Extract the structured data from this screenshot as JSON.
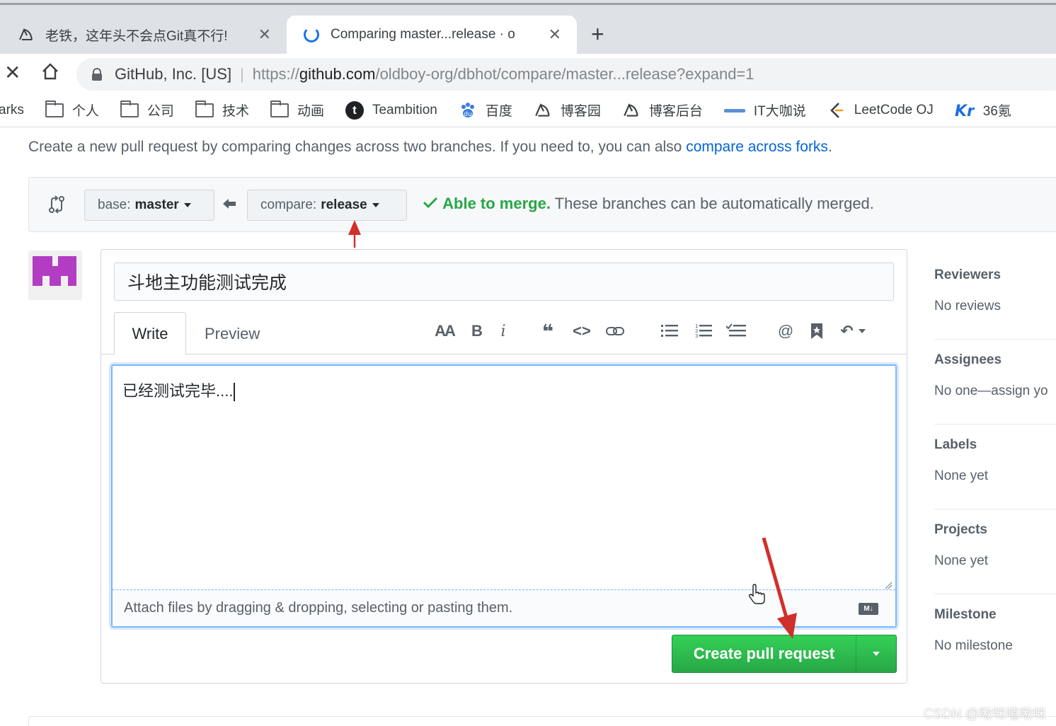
{
  "browser": {
    "tabs": [
      {
        "title": "老铁，这年头不会点Git真不行!",
        "active": false,
        "favicon": "cnblogs-icon"
      },
      {
        "title": "Comparing master...release · o",
        "active": true,
        "favicon": "loading-spinner-icon"
      }
    ],
    "new_tab_label": "+",
    "close_glyph": "✕",
    "stop_glyph": "✕",
    "home_glyph": "⌂",
    "address": {
      "org": "GitHub, Inc. [US]",
      "separator": "|",
      "scheme": "https://",
      "host": "github.com",
      "path": "/oldboy-org/dbhot/compare/master...release?expand=1"
    },
    "bookmarks": [
      {
        "label": "arks",
        "icon": "none"
      },
      {
        "label": "个人",
        "icon": "folder-icon"
      },
      {
        "label": "公司",
        "icon": "folder-icon"
      },
      {
        "label": "技术",
        "icon": "folder-icon"
      },
      {
        "label": "动画",
        "icon": "folder-icon"
      },
      {
        "label": "Teambition",
        "icon": "teambition-icon"
      },
      {
        "label": "百度",
        "icon": "baidu-paw-icon"
      },
      {
        "label": "博客园",
        "icon": "cnblogs-icon"
      },
      {
        "label": "博客后台",
        "icon": "cnblogs-icon"
      },
      {
        "label": "IT大咖说",
        "icon": "itdks-icon"
      },
      {
        "label": "LeetCode OJ",
        "icon": "leetcode-icon"
      },
      {
        "label": "36氪",
        "icon": "kr36-icon"
      }
    ]
  },
  "page": {
    "intro_text": "Create a new pull request by comparing changes across two branches. If you need to, you can also ",
    "intro_link": "compare across forks",
    "intro_end": ".",
    "base_prefix": "base:",
    "base_branch": "master",
    "compare_prefix": "compare:",
    "compare_branch": "release",
    "merge_ok": "Able to merge.",
    "merge_text": " These branches can be automatically merged.",
    "pr_title": "斗地主功能测试完成",
    "tab_write": "Write",
    "tab_preview": "Preview",
    "toolbar_icons": [
      "text-size-icon",
      "bold-icon",
      "italic-icon",
      "quote-icon",
      "code-icon",
      "link-icon",
      "unordered-list-icon",
      "ordered-list-icon",
      "task-list-icon",
      "mention-icon",
      "reference-icon",
      "reply-icon"
    ],
    "tool_glyphs": {
      "text_size": "AA",
      "bold": "B",
      "italic": "i",
      "quote": "❝",
      "code": "<>",
      "mention": "@",
      "reply": "↶"
    },
    "body_text": "已经测试完毕....",
    "attach_hint": "Attach files by dragging & dropping, selecting or pasting them.",
    "markdown_badge": "M↓",
    "submit_label": "Create pull request"
  },
  "sidebar": [
    {
      "heading": "Reviewers",
      "value": "No reviews"
    },
    {
      "heading": "Assignees",
      "value": "No one—assign yo"
    },
    {
      "heading": "Labels",
      "value": "None yet"
    },
    {
      "heading": "Projects",
      "value": "None yet"
    },
    {
      "heading": "Milestone",
      "value": "No milestone"
    }
  ],
  "watermark": "CSDN @啾咪嘻啾咪",
  "colors": {
    "link": "#0366d6",
    "success": "#28a745",
    "button_green": "#2ea44f",
    "annotation_red": "#d0302b",
    "avatar_purple": "#b23dc3"
  }
}
